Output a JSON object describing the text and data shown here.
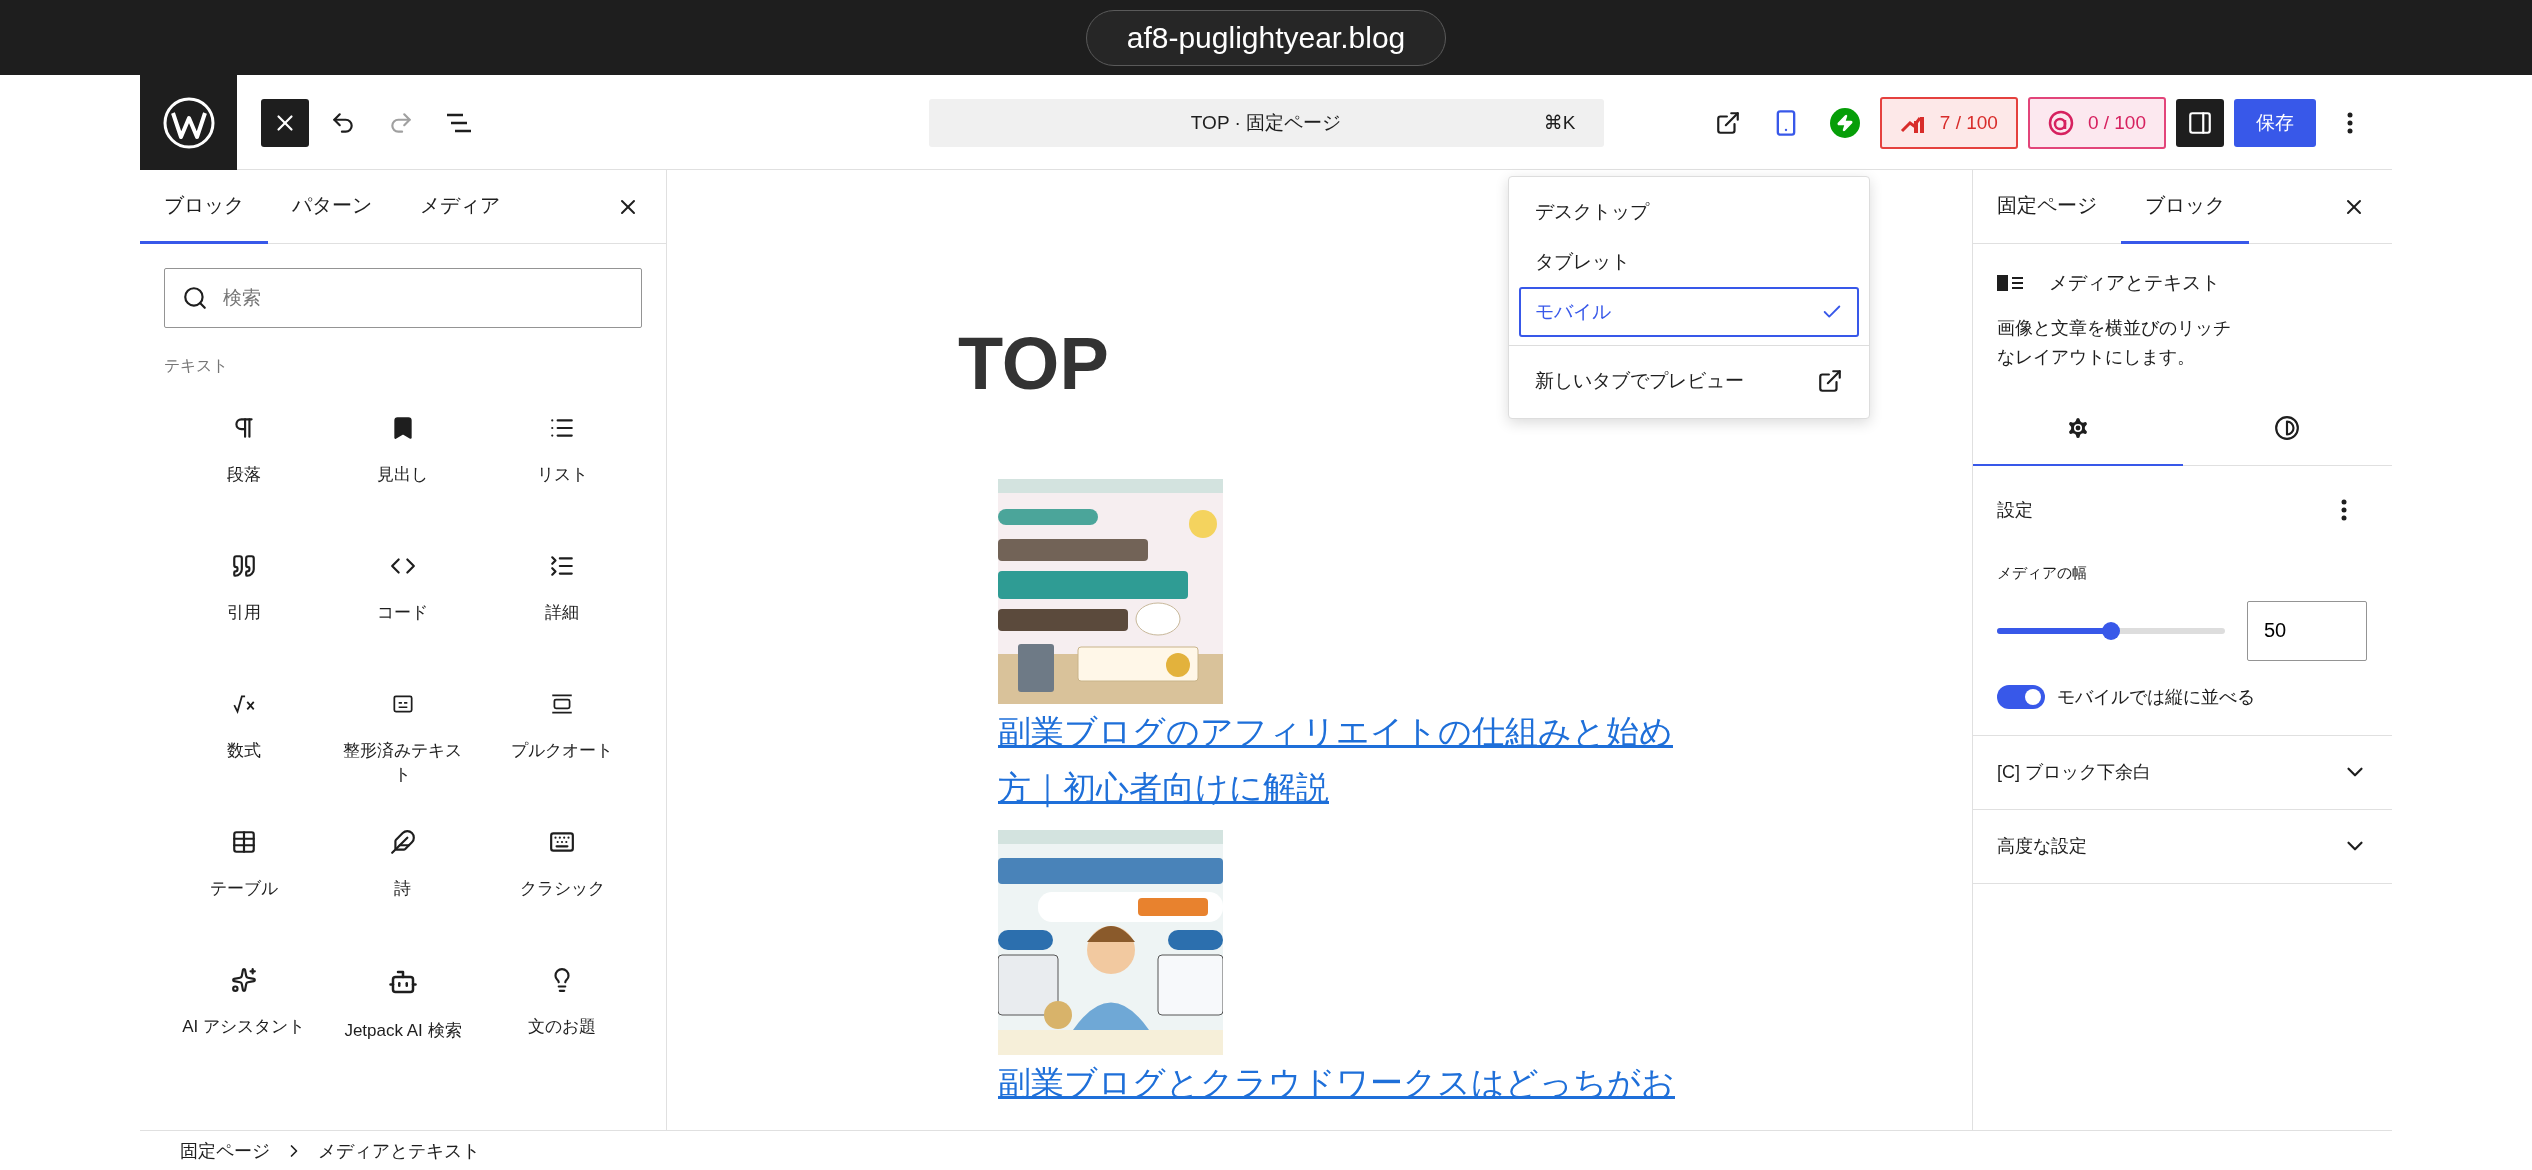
{
  "browser": {
    "url": "af8-puglightyear.blog"
  },
  "toolbar": {
    "inserter_open": true,
    "document_title": "TOP · 固定ページ",
    "shortcut": "⌘K",
    "seo_score": "7 / 100",
    "ai_score": "0 / 100",
    "sidebar_open": true,
    "save": "保存"
  },
  "preview_menu": {
    "items": [
      {
        "label": "デスクトップ",
        "selected": false
      },
      {
        "label": "タブレット",
        "selected": false
      },
      {
        "label": "モバイル",
        "selected": true
      }
    ],
    "open_in_new_tab": "新しいタブでプレビュー"
  },
  "inserter": {
    "tabs": [
      {
        "label": "ブロック",
        "selected": true
      },
      {
        "label": "パターン",
        "selected": false
      },
      {
        "label": "メディア",
        "selected": false
      }
    ],
    "search": {
      "placeholder": "検索"
    },
    "category": "テキスト",
    "blocks": [
      {
        "kind": "paragraph",
        "label": "段落"
      },
      {
        "kind": "heading",
        "label": "見出し"
      },
      {
        "kind": "list",
        "label": "リスト"
      },
      {
        "kind": "quote",
        "label": "引用"
      },
      {
        "kind": "code",
        "label": "コード"
      },
      {
        "kind": "details",
        "label": "詳細"
      },
      {
        "kind": "math",
        "label": "数式"
      },
      {
        "kind": "preformatted",
        "label": "整形済みテキスト"
      },
      {
        "kind": "pullquote",
        "label": "プルクオート"
      },
      {
        "kind": "table",
        "label": "テーブル"
      },
      {
        "kind": "verse",
        "label": "詩"
      },
      {
        "kind": "classic",
        "label": "クラシック"
      },
      {
        "kind": "ai",
        "label": "AI アシスタント"
      },
      {
        "kind": "bot",
        "label": "Jetpack AI 検索"
      },
      {
        "kind": "prompt",
        "label": "文のお題"
      }
    ]
  },
  "canvas": {
    "title": "TOP",
    "posts": [
      {
        "kind": "picture",
        "title": "副業ブログのアフィリエイトの仕組みと始め方｜初心者向けに解説"
      },
      {
        "kind": "picture",
        "title": "副業ブログとクラウドワークスはどっちがお"
      }
    ]
  },
  "sidebar": {
    "tabs": [
      {
        "label": "固定ページ",
        "selected": false
      },
      {
        "label": "ブロック",
        "selected": true
      }
    ],
    "block": {
      "name": "メディアとテキスト",
      "description": "画像と文章を横並びのリッチなレイアウトにします。"
    },
    "view_tabs": [
      {
        "kind": "settings",
        "selected": true
      },
      {
        "kind": "styles",
        "selected": false
      }
    ],
    "settings": {
      "title": "設定",
      "media_width": {
        "label": "メディアの幅",
        "level": 0.5,
        "value": "50"
      },
      "stack_on_mobile": {
        "label": "モバイルでは縦に並べる",
        "on": true
      }
    },
    "panels": [
      {
        "label": "[C] ブロック下余白",
        "expanded": false
      },
      {
        "label": "高度な設定",
        "expanded": false
      }
    ]
  },
  "breadcrumb": [
    "固定ページ",
    "メディアとテキスト"
  ]
}
